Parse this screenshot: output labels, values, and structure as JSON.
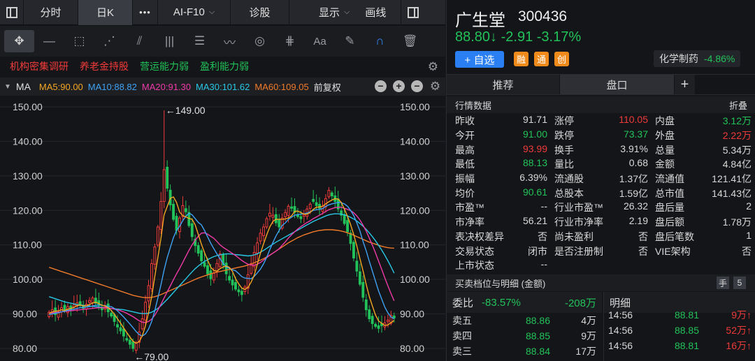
{
  "toolbar": {
    "period_tabs": [
      "分时",
      "日K"
    ],
    "more": "•••",
    "ai_tab": "AI-F10",
    "diagnose": "诊股",
    "display": "显示",
    "draw": "画线"
  },
  "tags": [
    {
      "label": "机构密集调研",
      "color": "red"
    },
    {
      "label": "养老金持股",
      "color": "red"
    },
    {
      "label": "营运能力弱",
      "color": "green"
    },
    {
      "label": "盈利能力弱",
      "color": "green"
    }
  ],
  "ma_legend": {
    "label": "MA",
    "items": [
      {
        "text": "MA5:90.00",
        "color": "#f5a623"
      },
      {
        "text": "MA10:88.82",
        "color": "#3ea2f5"
      },
      {
        "text": "MA20:91.30",
        "color": "#ef3aa8"
      },
      {
        "text": "MA30:101.62",
        "color": "#28c8e6"
      },
      {
        "text": "MA60:109.05",
        "color": "#f07a2a"
      }
    ],
    "adjust": "前复权"
  },
  "chart_data": {
    "type": "candlestick",
    "y_ticks": [
      "150.00",
      "140.00",
      "130.00",
      "120.00",
      "110.00",
      "100.00",
      "90.00",
      "80.00"
    ],
    "ylim": [
      78,
      152
    ],
    "high_annotation": "←149.00",
    "low_annotation": "←79.00",
    "high": 149.0,
    "low": 79.0,
    "closes": [
      90.5,
      91.2,
      89.8,
      90.6,
      91.8,
      90.9,
      92.1,
      91.4,
      92.6,
      93.2,
      92.4,
      91.6,
      92.8,
      93.9,
      94.6,
      93.1,
      92.4,
      91.2,
      92.0,
      90.6,
      89.4,
      87.8,
      86.2,
      85.1,
      83.6,
      82.4,
      81.2,
      80.0,
      81.6,
      84.8,
      88.6,
      93.4,
      98.2,
      104.6,
      109.4,
      115.2,
      122.6,
      131.8,
      126.4,
      121.6,
      117.4,
      114.2,
      117.8,
      121.4,
      119.6,
      115.6,
      112.4,
      109.8,
      107.6,
      105.4,
      103.8,
      101.6,
      100.2,
      101.8,
      104.6,
      107.4,
      104.2,
      101.6,
      99.8,
      98.4,
      97.2,
      96.4,
      95.6,
      97.8,
      101.4,
      104.6,
      107.8,
      110.6,
      113.4,
      115.2,
      117.6,
      119.2,
      118.6,
      116.4,
      115.2,
      117.8,
      119.4,
      121.2,
      120.6,
      119.4,
      118.2,
      117.6,
      118.8,
      120.4,
      121.8,
      122.6,
      121.4,
      120.6,
      121.2,
      123.4,
      125.8,
      124.2,
      122.6,
      120.4,
      118.6,
      116.2,
      113.8,
      110.4,
      106.2,
      102.4,
      98.6,
      94.8,
      91.2,
      88.6,
      87.2,
      86.4,
      85.8,
      86.6,
      87.4,
      88.2,
      89.6,
      88.8
    ],
    "ma5": [
      90.1,
      90.6,
      90.8,
      90.9,
      91.2,
      91.0,
      91.4,
      91.6,
      91.9,
      92.4,
      92.6,
      92.3,
      92.4,
      92.7,
      93.2,
      93.4,
      93.0,
      92.5,
      92.3,
      91.8,
      91.0,
      89.9,
      88.6,
      87.3,
      85.9,
      84.6,
      83.3,
      82.1,
      81.5,
      82.0,
      83.7,
      86.6,
      90.4,
      95.0,
      100.8,
      106.3,
      112.0,
      118.7,
      121.1,
      123.5,
      123.9,
      122.3,
      119.5,
      118.5,
      118.1,
      117.7,
      117.4,
      115.8,
      113.0,
      110.2,
      107.8,
      105.6,
      103.5,
      102.6,
      102.4,
      103.1,
      103.6,
      103.9,
      103.5,
      102.3,
      100.2,
      98.7,
      97.5,
      97.1,
      97.7,
      99.2,
      101.2,
      104.4,
      107.6,
      110.3,
      112.9,
      115.2,
      116.8,
      117.4,
      117.4,
      117.4,
      117.5,
      117.8,
      118.4,
      119.7,
      119.8,
      119.4,
      118.9,
      118.9,
      119.4,
      120.3,
      120.9,
      121.0,
      121.2,
      121.9,
      122.5,
      123.0,
      123.4,
      123.3,
      122.3,
      120.4,
      118.3,
      115.9,
      113.0,
      109.7,
      106.0,
      102.5,
      98.6,
      95.1,
      92.3,
      89.7,
      88.0,
      87.3,
      86.7,
      86.8,
      87.5,
      88.1
    ],
    "ma10": [
      89.8,
      90.0,
      90.2,
      90.3,
      90.6,
      90.8,
      91.0,
      91.2,
      91.4,
      91.6,
      91.8,
      91.9,
      92.0,
      92.1,
      92.3,
      92.5,
      92.6,
      92.5,
      92.4,
      92.2,
      92.1,
      91.6,
      90.9,
      90.0,
      89.1,
      88.1,
      87.1,
      86.0,
      84.9,
      84.0,
      83.6,
      84.2,
      85.6,
      87.8,
      90.9,
      94.6,
      98.5,
      102.7,
      106.3,
      109.2,
      112.1,
      114.2,
      115.4,
      117.0,
      118.3,
      119.2,
      118.7,
      117.6,
      116.5,
      115.8,
      114.2,
      112.3,
      110.5,
      108.9,
      107.4,
      106.0,
      104.6,
      103.6,
      103.2,
      102.8,
      102.5,
      101.7,
      100.8,
      100.4,
      100.3,
      100.2,
      100.9,
      101.9,
      103.0,
      104.5,
      106.4,
      108.6,
      110.7,
      112.6,
      114.2,
      115.6,
      116.4,
      117.4,
      118.0,
      118.6,
      118.8,
      118.9,
      119.0,
      119.2,
      119.6,
      120.0,
      120.2,
      120.3,
      120.5,
      121.2,
      121.6,
      121.9,
      122.1,
      122.3,
      122.2,
      121.9,
      121.2,
      120.0,
      118.5,
      116.4,
      114.0,
      111.0,
      108.3,
      105.3,
      102.4,
      99.5,
      96.7,
      94.3,
      92.0,
      90.3,
      89.1,
      88.6
    ],
    "ma20": [
      90.2,
      90.3,
      90.4,
      90.5,
      90.6,
      90.7,
      90.8,
      90.9,
      91.0,
      91.1,
      91.2,
      91.3,
      91.4,
      91.5,
      91.6,
      91.7,
      91.8,
      91.8,
      91.8,
      91.7,
      91.6,
      91.4,
      91.2,
      90.9,
      90.6,
      90.2,
      89.7,
      89.2,
      88.6,
      88.0,
      87.6,
      87.5,
      87.8,
      88.5,
      89.6,
      91.1,
      92.8,
      94.6,
      96.4,
      98.1,
      99.9,
      101.6,
      103.2,
      104.9,
      106.7,
      108.4,
      110.0,
      111.4,
      112.5,
      113.4,
      113.5,
      113.1,
      112.5,
      111.9,
      111.0,
      110.0,
      109.3,
      108.7,
      108.1,
      107.5,
      106.9,
      106.2,
      105.5,
      104.9,
      104.4,
      104.2,
      104.1,
      104.4,
      104.9,
      105.6,
      106.3,
      107.0,
      107.6,
      108.2,
      108.9,
      109.9,
      110.9,
      112.0,
      112.9,
      113.8,
      114.6,
      115.3,
      115.9,
      116.5,
      117.0,
      117.6,
      118.1,
      118.6,
      119.1,
      119.7,
      120.2,
      120.5,
      120.8,
      120.9,
      120.9,
      120.6,
      120.3,
      119.9,
      119.3,
      118.4,
      117.2,
      115.7,
      114.0,
      112.0,
      109.9,
      107.7,
      105.3,
      102.9,
      100.5,
      98.1,
      95.9,
      93.8
    ],
    "ma30": [
      95.0,
      94.7,
      94.4,
      94.1,
      93.8,
      93.5,
      93.3,
      93.1,
      92.9,
      92.7,
      92.6,
      92.5,
      92.4,
      92.3,
      92.2,
      92.1,
      92.0,
      91.9,
      91.8,
      91.7,
      91.6,
      91.5,
      91.4,
      91.3,
      91.2,
      91.0,
      90.8,
      90.6,
      90.4,
      90.2,
      90.1,
      90.1,
      90.2,
      90.5,
      91.0,
      91.6,
      92.4,
      93.3,
      94.2,
      95.2,
      96.2,
      97.2,
      98.2,
      99.2,
      100.2,
      101.2,
      102.2,
      103.1,
      103.9,
      104.6,
      105.2,
      105.7,
      106.2,
      106.6,
      106.9,
      107.1,
      107.3,
      107.4,
      107.4,
      107.3,
      107.2,
      107.1,
      107.0,
      106.9,
      106.8,
      106.9,
      107.1,
      107.4,
      107.9,
      108.4,
      109.0,
      109.6,
      110.2,
      110.8,
      111.3,
      111.8,
      112.3,
      112.8,
      113.3,
      113.8,
      114.3,
      114.8,
      115.3,
      115.8,
      116.3,
      116.8,
      117.2,
      117.6,
      118.0,
      118.4,
      118.7,
      118.9,
      119.0,
      119.0,
      118.9,
      118.7,
      118.4,
      118.0,
      117.5,
      116.9,
      116.2,
      115.4,
      114.5,
      113.5,
      112.4,
      111.2,
      109.9,
      108.5,
      107.0,
      105.4,
      103.7,
      101.8
    ],
    "ma60": [
      103.5,
      103.2,
      102.9,
      102.6,
      102.3,
      102.0,
      101.7,
      101.4,
      101.1,
      100.8,
      100.5,
      100.2,
      99.9,
      99.6,
      99.3,
      99.0,
      98.7,
      98.4,
      98.1,
      97.8,
      97.5,
      97.2,
      96.9,
      96.6,
      96.3,
      96.0,
      95.7,
      95.4,
      95.2,
      95.0,
      94.8,
      94.7,
      94.7,
      94.8,
      95.0,
      95.3,
      95.6,
      96.0,
      96.4,
      96.8,
      97.2,
      97.6,
      98.0,
      98.4,
      98.8,
      99.2,
      99.6,
      100.0,
      100.4,
      100.7,
      101.0,
      101.3,
      101.6,
      101.9,
      102.1,
      102.3,
      102.5,
      102.7,
      102.9,
      103.1,
      103.3,
      103.5,
      103.7,
      103.9,
      104.2,
      104.5,
      104.8,
      105.2,
      105.6,
      106.0,
      106.5,
      107.0,
      107.6,
      108.2,
      108.8,
      109.4,
      110.0,
      110.6,
      111.1,
      111.6,
      112.1,
      112.5,
      112.9,
      113.2,
      113.5,
      113.8,
      114.0,
      114.2,
      114.3,
      114.4,
      114.4,
      114.4,
      114.3,
      114.2,
      114.0,
      113.8,
      113.5,
      113.2,
      112.8,
      112.4,
      112.0,
      111.6,
      111.2,
      110.8,
      110.5,
      110.2,
      109.9,
      109.6,
      109.4,
      109.2,
      109.1,
      109.05
    ]
  },
  "quote": {
    "name": "广生堂",
    "code": "300436",
    "price_line": "88.80↓ -2.91 -3.17%",
    "add_label": "+ 自选",
    "badges": [
      "融",
      "通",
      "创"
    ],
    "sector_name": "化学制药",
    "sector_change": "-4.86%"
  },
  "right_tabs": [
    "推荐",
    "盘口",
    "+"
  ],
  "market_data": {
    "title": "行情数据",
    "fold": "折叠",
    "rows": [
      [
        [
          "昨收",
          "91.71",
          ""
        ],
        [
          "涨停",
          "110.05",
          "red"
        ],
        [
          "内盘",
          "3.12万",
          "green"
        ]
      ],
      [
        [
          "今开",
          "91.00",
          "green"
        ],
        [
          "跌停",
          "73.37",
          "green"
        ],
        [
          "外盘",
          "2.22万",
          "red"
        ]
      ],
      [
        [
          "最高",
          "93.99",
          "red"
        ],
        [
          "换手",
          "3.91%",
          ""
        ],
        [
          "总量",
          "5.34万",
          ""
        ]
      ],
      [
        [
          "最低",
          "88.13",
          "green"
        ],
        [
          "量比",
          "0.68",
          ""
        ],
        [
          "金额",
          "4.84亿",
          ""
        ]
      ],
      [
        [
          "振幅",
          "6.39%",
          ""
        ],
        [
          "流通股",
          "1.37亿",
          ""
        ],
        [
          "流通值",
          "121.41亿",
          ""
        ]
      ],
      [
        [
          "均价",
          "90.61",
          "green"
        ],
        [
          "总股本",
          "1.59亿",
          ""
        ],
        [
          "总市值",
          "141.43亿",
          ""
        ]
      ],
      [
        [
          "市盈™",
          "--",
          ""
        ],
        [
          "行业市盈™",
          "26.32",
          ""
        ],
        [
          "盘后量",
          "2",
          ""
        ]
      ],
      [
        [
          "市净率",
          "56.21",
          ""
        ],
        [
          "行业市净率",
          "2.19",
          ""
        ],
        [
          "盘后额",
          "1.78万",
          ""
        ]
      ],
      [
        [
          "表决权差异",
          "否",
          ""
        ],
        [
          "尚未盈利",
          "否",
          ""
        ],
        [
          "盘后笔数",
          "1",
          ""
        ]
      ],
      [
        [
          "交易状态",
          "闭市",
          ""
        ],
        [
          "是否注册制",
          "否",
          ""
        ],
        [
          "VIE架构",
          "否",
          ""
        ]
      ],
      [
        [
          "上市状态",
          "--",
          ""
        ],
        [
          "",
          "",
          ""
        ],
        [
          "",
          "",
          ""
        ]
      ]
    ]
  },
  "book": {
    "title": "买卖档位与明细 (金额)",
    "btn_hand": "手",
    "btn_five": "5",
    "weibi_label": "委比",
    "weibi_pct": "-83.57%",
    "weibi_amt": "-208万",
    "asks": [
      {
        "name": "卖五",
        "price": "88.86",
        "qty": "4万"
      },
      {
        "name": "卖四",
        "price": "88.85",
        "qty": "9万"
      },
      {
        "name": "卖三",
        "price": "88.84",
        "qty": "17万"
      }
    ],
    "ticks_title": "明细",
    "ticks": [
      {
        "time": "14:56",
        "price": "88.81",
        "qty": "9万↑"
      },
      {
        "time": "14:56",
        "price": "88.85",
        "qty": "52万↑"
      },
      {
        "time": "14:56",
        "price": "88.81",
        "qty": "16万↑"
      }
    ]
  }
}
